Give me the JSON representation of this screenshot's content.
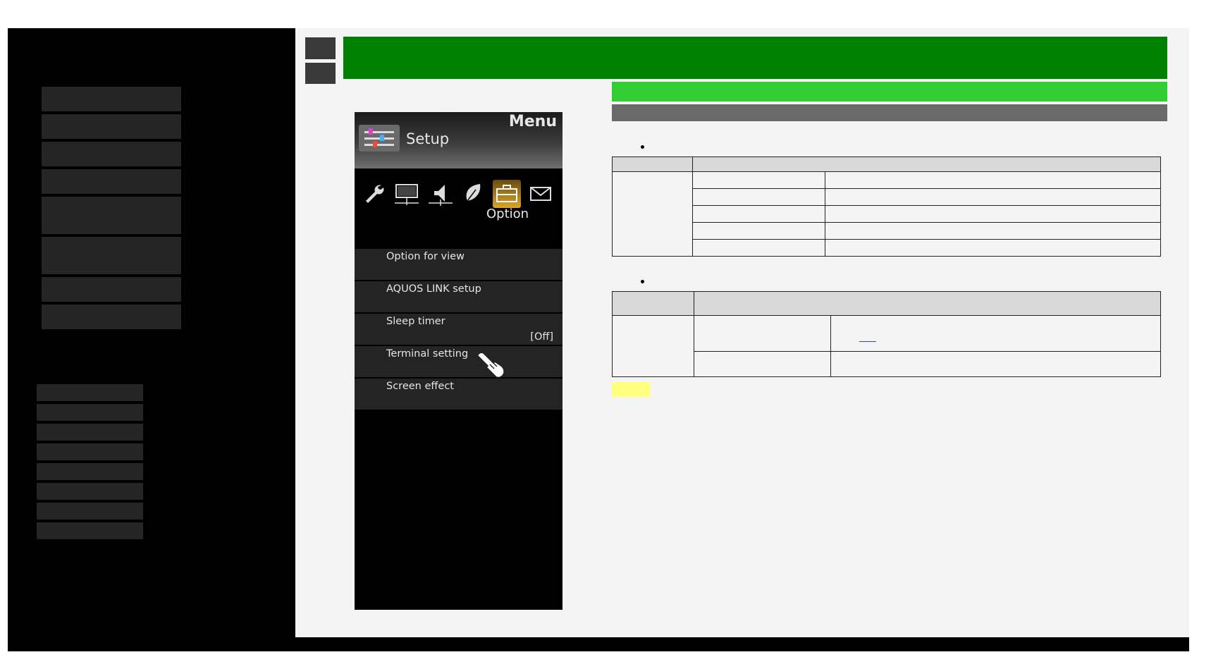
{
  "tv_menu": {
    "menu_title": "Menu",
    "section_title": "Setup",
    "active_tab_label": "Option",
    "tabs": [
      "wrench-icon",
      "monitor-icon",
      "speaker-icon",
      "leaf-icon",
      "toolbox-icon",
      "envelope-icon"
    ],
    "items": [
      {
        "label": "Option for view",
        "value": ""
      },
      {
        "label": "AQUOS LINK setup",
        "value": ""
      },
      {
        "label": "Sleep timer",
        "value": "[Off]"
      },
      {
        "label": "Terminal setting",
        "value": ""
      },
      {
        "label": "Screen effect",
        "value": ""
      }
    ]
  },
  "colors": {
    "header_green": "#008000",
    "subheader_green": "#32cd32",
    "active_tab_gold": "#e0a526",
    "note_yellow": "#ffff80"
  }
}
